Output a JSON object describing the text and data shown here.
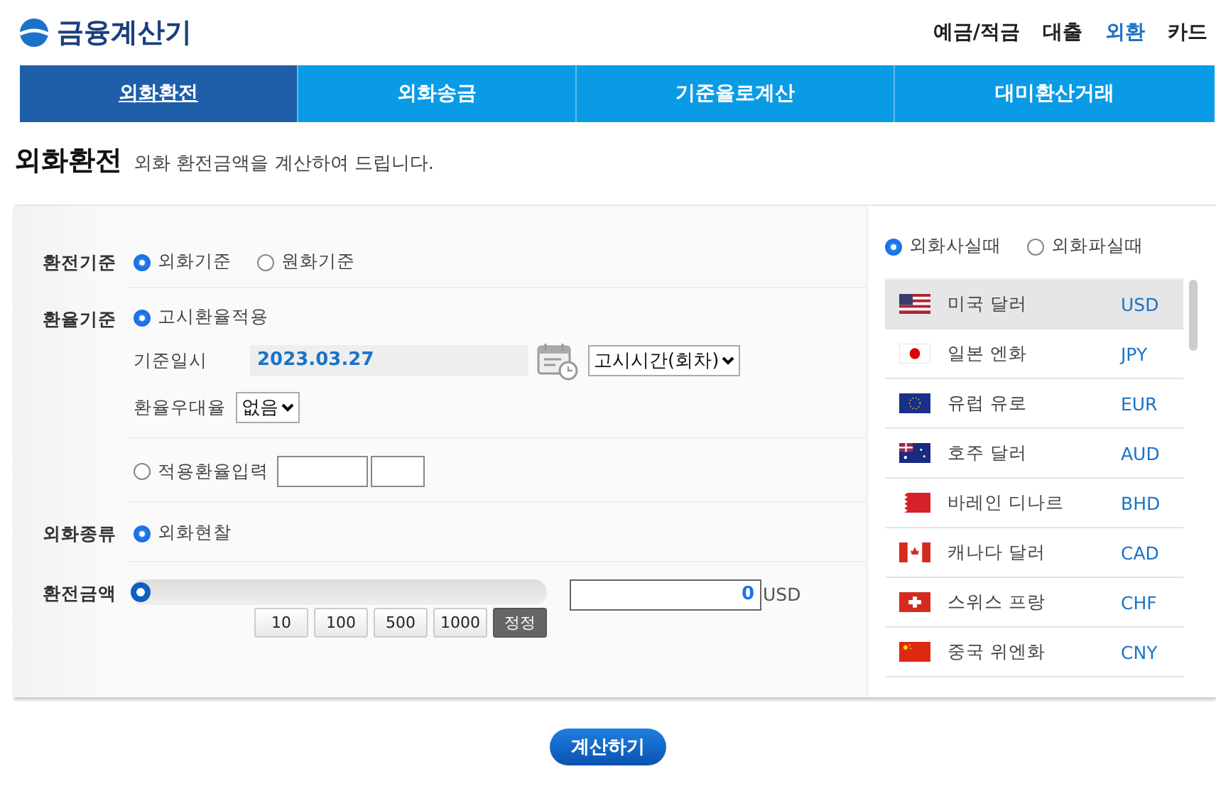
{
  "logo": {
    "text": "금융계산기"
  },
  "top_menu": [
    {
      "label": "예금/적금",
      "selected": false
    },
    {
      "label": "대출",
      "selected": false
    },
    {
      "label": "외환",
      "selected": true
    },
    {
      "label": "카드",
      "selected": false
    }
  ],
  "tabs": [
    {
      "label": "외화환전",
      "selected": true
    },
    {
      "label": "외화송금",
      "selected": false
    },
    {
      "label": "기준율로계산",
      "selected": false
    },
    {
      "label": "대미환산거래",
      "selected": false
    }
  ],
  "heading": {
    "title": "외화환전",
    "subtitle": "외화 환전금액을 계산하여 드립니다."
  },
  "exchange_basis": {
    "label": "환전기준",
    "options": [
      {
        "label": "외화기준",
        "selected": true
      },
      {
        "label": "원화기준",
        "selected": false
      }
    ]
  },
  "rate_basis": {
    "label": "환율기준",
    "notice_option": {
      "label": "고시환율적용",
      "selected": true
    },
    "date_label": "기준일시",
    "date": "2023.03.27",
    "time_select": "고시시간(회차)",
    "preference_label": "환율우대율",
    "preference_select": "없음",
    "manual_option": {
      "label": "적용환율입력",
      "selected": false
    }
  },
  "currency_type": {
    "label": "외화종류",
    "options": [
      {
        "label": "외화현찰",
        "selected": true
      }
    ]
  },
  "amount": {
    "label": "환전금액",
    "level": 0,
    "value": "0",
    "unit": "USD",
    "quick_buttons": [
      {
        "label": "10",
        "kind": "add"
      },
      {
        "label": "100",
        "kind": "add"
      },
      {
        "label": "500",
        "kind": "add"
      },
      {
        "label": "1000",
        "kind": "add"
      },
      {
        "label": "정정",
        "kind": "reset"
      }
    ]
  },
  "trade": {
    "options": [
      {
        "label": "외화사실때",
        "selected": true
      },
      {
        "label": "외화파실때",
        "selected": false
      }
    ]
  },
  "currencies": [
    {
      "name": "미국 달러",
      "code": "USD",
      "selected": true
    },
    {
      "name": "일본 엔화",
      "code": "JPY",
      "selected": false
    },
    {
      "name": "유럽 유로",
      "code": "EUR",
      "selected": false
    },
    {
      "name": "호주 달러",
      "code": "AUD",
      "selected": false
    },
    {
      "name": "바레인 디나르",
      "code": "BHD",
      "selected": false
    },
    {
      "name": "캐나다 달러",
      "code": "CAD",
      "selected": false
    },
    {
      "name": "스위스 프랑",
      "code": "CHF",
      "selected": false
    },
    {
      "name": "중국 위엔화",
      "code": "CNY",
      "selected": false
    }
  ],
  "calculate_button": "계산하기"
}
